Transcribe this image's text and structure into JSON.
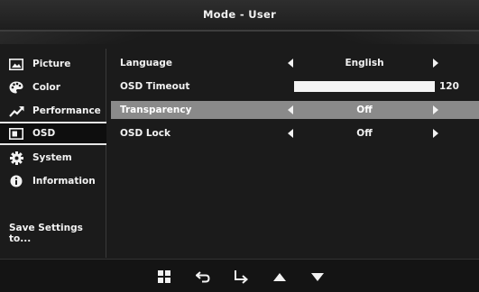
{
  "header": {
    "title": "Mode - User"
  },
  "sidebar": {
    "items": [
      {
        "label": "Picture",
        "icon": "picture-icon",
        "active": false
      },
      {
        "label": "Color",
        "icon": "palette-icon",
        "active": false
      },
      {
        "label": "Performance",
        "icon": "trend-icon",
        "active": false
      },
      {
        "label": "OSD",
        "icon": "osd-icon",
        "active": true
      },
      {
        "label": "System",
        "icon": "gear-icon",
        "active": false
      },
      {
        "label": "Information",
        "icon": "info-icon",
        "active": false
      }
    ],
    "save_label": "Save Settings to..."
  },
  "settings": {
    "language": {
      "label": "Language",
      "value": "English"
    },
    "osd_timeout": {
      "label": "OSD Timeout",
      "value": "120",
      "fraction": 1.0
    },
    "transparency": {
      "label": "Transparency",
      "value": "Off",
      "highlighted": true
    },
    "osd_lock": {
      "label": "OSD Lock",
      "value": "Off"
    }
  },
  "footer": {
    "buttons": [
      "menu-icon",
      "back-icon",
      "enter-icon",
      "up-icon",
      "down-icon"
    ]
  },
  "colors": {
    "highlight": "#8a8a8a",
    "background": "#1b1b1b",
    "text": "#f2f2f2"
  }
}
